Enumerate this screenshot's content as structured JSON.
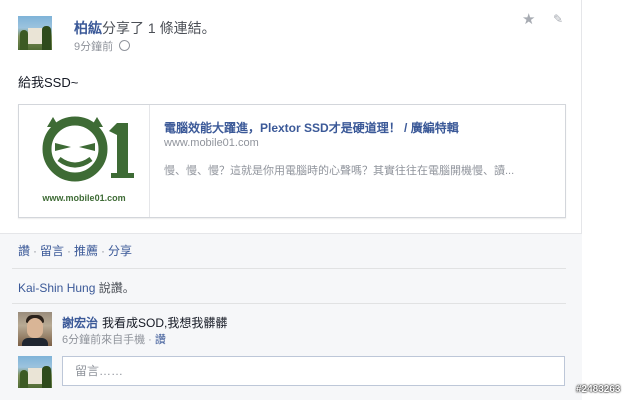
{
  "post": {
    "author": "柏紘",
    "action": "分享了 1 條連結。",
    "time": "9分鐘前",
    "privacy_icon": "globe-icon",
    "text": "給我SSD~"
  },
  "link": {
    "thumbnail_caption": "www.mobile01.com",
    "title": "電腦效能大躍進，Plextor SSD才是硬道理！ / 廣編特輯",
    "domain": "www.mobile01.com",
    "description": "慢、慢、慢？這就是你用電腦時的心聲嗎？其實往往在電腦開機慢、讀..."
  },
  "actions": {
    "like": "讚",
    "comment": "留言",
    "promote": "推薦",
    "share": "分享",
    "separator": "·"
  },
  "likes": {
    "name": "Kai-Shin Hung",
    "suffix": " 說讚。"
  },
  "comment": {
    "author": "謝宏治",
    "text": "我看成SOD,我想我髒髒",
    "meta": "6分鐘前來自手機 · ",
    "like": "讚"
  },
  "comment_box": {
    "placeholder": "留言……"
  },
  "watermark": "#2483263",
  "colors": {
    "link_blue": "#3b5998",
    "meta_gray": "#90949c",
    "logo_green": "#3e6b35"
  }
}
